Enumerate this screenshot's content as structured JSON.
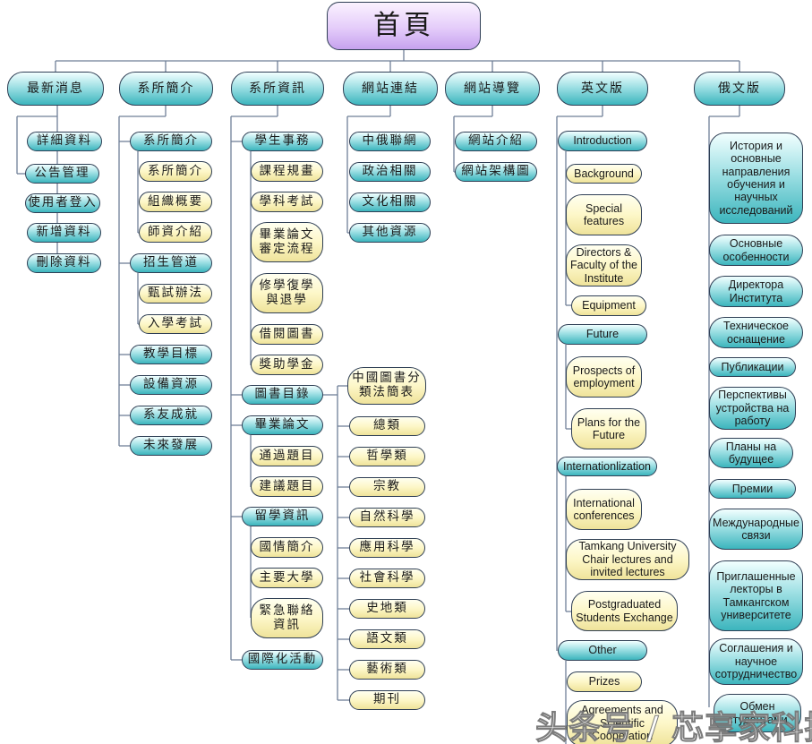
{
  "root": "首頁",
  "sections": [
    {
      "label": "最新消息",
      "children": [
        "詳細資料",
        "公告管理",
        "使用者登入",
        "新增資料",
        "刪除資料"
      ]
    },
    {
      "label": "系所簡介",
      "children": [
        {
          "label": "系所簡介",
          "children": [
            "系所簡介",
            "組織概要",
            "師資介紹"
          ]
        },
        {
          "label": "招生管道",
          "children": [
            "甄試辦法",
            "入學考試"
          ]
        },
        "教學目標",
        "設備資源",
        "系友成就",
        "未來發展"
      ]
    },
    {
      "label": "系所資訊",
      "children": [
        {
          "label": "學生事務",
          "children": [
            "課程規畫",
            "學科考試",
            "畢業論文審定流程",
            "修學復學與退學",
            "借閱圖書",
            "獎助學金"
          ]
        },
        {
          "label": "圖書目錄",
          "children": [
            "中國圖書分類法簡表",
            "總類",
            "哲學類",
            "宗教",
            "自然科學",
            "應用科學",
            "社會科學",
            "史地類",
            "語文類",
            "藝術類",
            "期刊"
          ]
        },
        {
          "label": "畢業論文",
          "children": [
            "通過題目",
            "建議題目"
          ]
        },
        {
          "label": "留學資訊",
          "children": [
            "國情簡介",
            "主要大學",
            "緊急聯絡資訊"
          ]
        },
        "國際化活動"
      ]
    },
    {
      "label": "網站連結",
      "children": [
        "中俄聯網",
        "政治相關",
        "文化相關",
        "其他資源"
      ]
    },
    {
      "label": "網站導覽",
      "children": [
        "網站介紹",
        "網站架構圖"
      ]
    },
    {
      "label": "英文版",
      "children": [
        {
          "label": "Introduction",
          "children": [
            "Background",
            "Special features",
            "Directors & Faculty of the Institute",
            "Equipment"
          ]
        },
        {
          "label": "Future",
          "children": [
            "Prospects of employment",
            "Plans for the Future"
          ]
        },
        {
          "label": "Internationlization",
          "children": [
            "International conferences",
            "Tamkang University Chair lectures and invited lectures",
            "Postgraduated Students Exchange"
          ]
        },
        {
          "label": "Other",
          "children": [
            "Prizes",
            "Agreements and Scientific Cooperation"
          ]
        }
      ]
    },
    {
      "label": "俄文版",
      "children": [
        "История и основные направления обучения и научных исследований",
        "Основные особенности",
        "Директора Института",
        "Техническое оснащение",
        "Публикации",
        "Перспективы устройства на работу",
        "Планы на будущее",
        "Премии",
        "Международные связи",
        "Приглашенные лекторы в Тамкангском университете",
        "Соглашения и научное сотрудничество",
        "Обмен студентами"
      ]
    }
  ],
  "watermark": "头条号 / 芯享家科技",
  "colors": {
    "branch": "#3cb5bd",
    "leaf": "#fdf7c8",
    "root": "#c6a2ee",
    "outline": "#2f3f55"
  }
}
